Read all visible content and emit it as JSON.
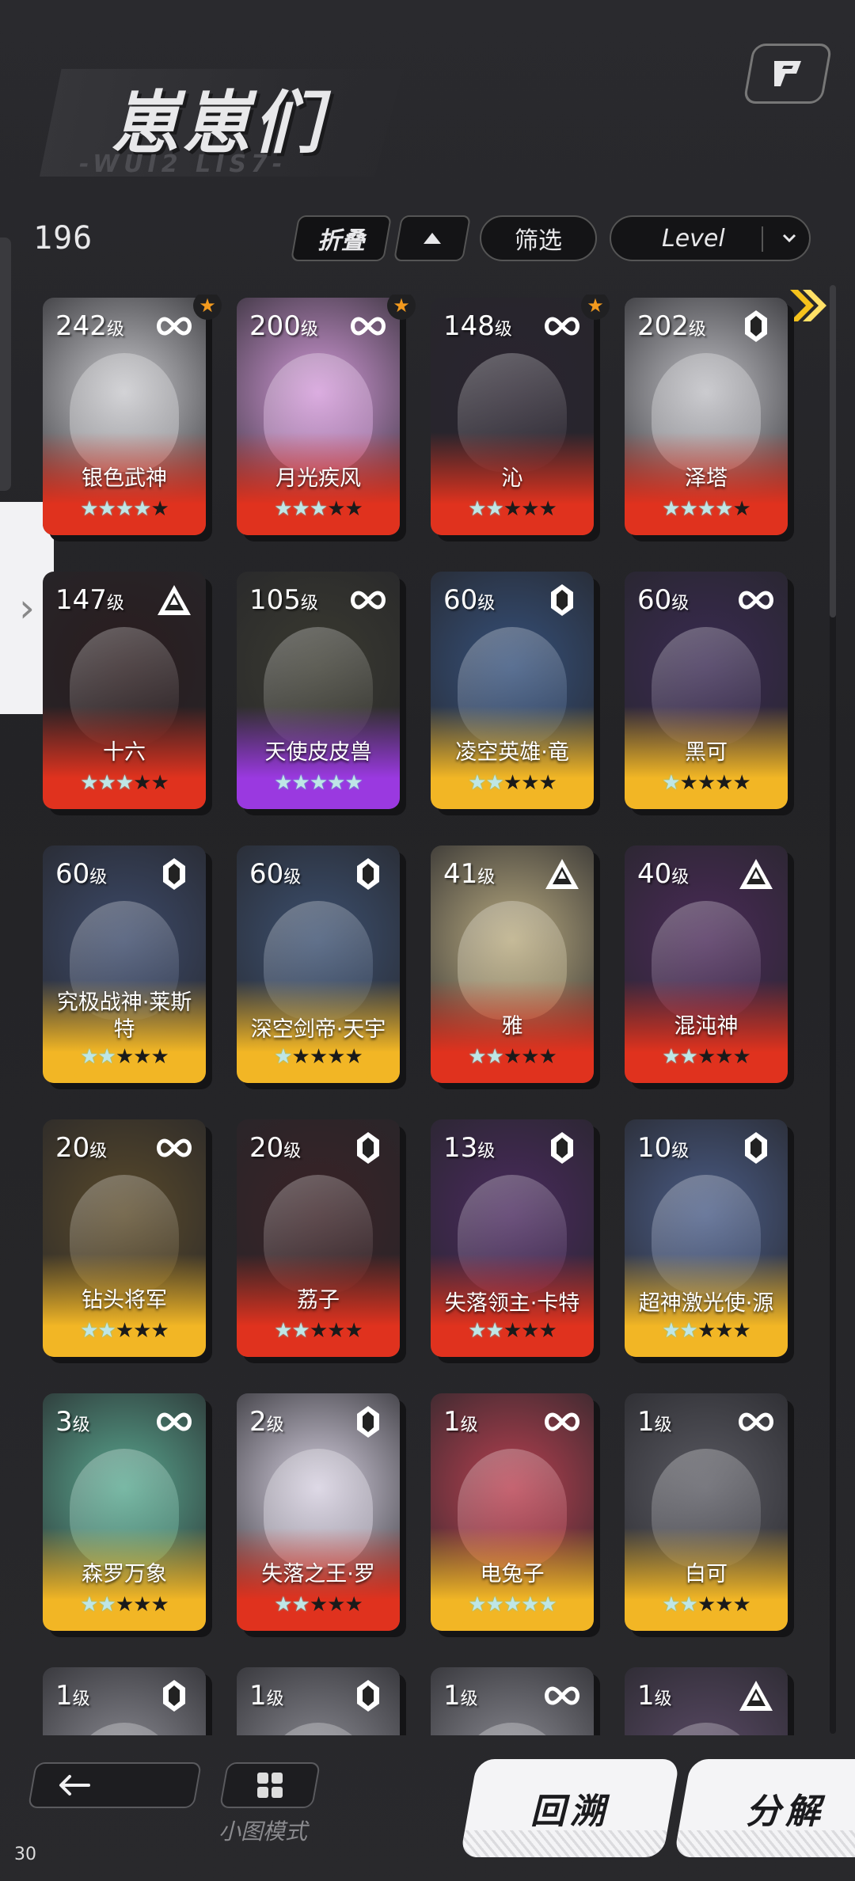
{
  "header": {
    "title": "崽崽们",
    "subtitle": "-WUI2 LIS7-",
    "count": "196"
  },
  "toolbar": {
    "fold_label": "折叠",
    "filter_label": "筛选",
    "sort_label": "Level"
  },
  "icons": {
    "top_right": "bookmark-flag-icon",
    "sort_dir": "triangle-up-icon",
    "chevron": "chevron-down-icon",
    "side_tab": "chevron-right-icon",
    "next": "double-arrow-right-icon",
    "back": "arrow-left-icon",
    "mini": "grid-icon"
  },
  "colors": {
    "red_rarity": "#e0321e",
    "gold_rarity": "#f2b625",
    "purple_rarity": "#9a39e0",
    "star": "#bfe6e6",
    "favorite": "#f39a1e"
  },
  "level_suffix": "级",
  "cards": [
    {
      "level": "242",
      "name": "银色武神",
      "badge": "infinity",
      "stars": 4,
      "max_stars": 5,
      "rarity": "red",
      "fav": true,
      "art": "#c9c9cd"
    },
    {
      "level": "200",
      "name": "月光疾风",
      "badge": "infinity",
      "stars": 3,
      "max_stars": 5,
      "rarity": "red",
      "fav": true,
      "art": "#d39ad9"
    },
    {
      "level": "148",
      "name": "沁",
      "badge": "infinity",
      "stars": 2,
      "max_stars": 5,
      "rarity": "red",
      "fav": true,
      "art": "#2a2430"
    },
    {
      "level": "202",
      "name": "泽塔",
      "badge": "crystal",
      "stars": 4,
      "max_stars": 5,
      "rarity": "red",
      "fav": false,
      "art": "#bfbfc4"
    },
    {
      "level": "147",
      "name": "十六",
      "badge": "triangle",
      "stars": 3,
      "max_stars": 5,
      "rarity": "red",
      "fav": false,
      "art": "#2a1c1e"
    },
    {
      "level": "105",
      "name": "天使皮皮兽",
      "badge": "infinity",
      "stars": 5,
      "max_stars": 5,
      "rarity": "purple",
      "fav": false,
      "art": "#3a3a30"
    },
    {
      "level": "60",
      "name": "凌空英雄·竜",
      "badge": "crystal",
      "stars": 2,
      "max_stars": 5,
      "rarity": "gold",
      "fav": false,
      "art": "#35507a"
    },
    {
      "level": "60",
      "name": "黑可",
      "badge": "infinity",
      "stars": 1,
      "max_stars": 5,
      "rarity": "gold",
      "fav": false,
      "art": "#3a2a52"
    },
    {
      "level": "60",
      "name": "究极战神·莱斯特",
      "badge": "crystal",
      "stars": 2,
      "max_stars": 5,
      "rarity": "gold",
      "fav": false,
      "art": "#3c4a6a"
    },
    {
      "level": "60",
      "name": "深空剑帝·天宇",
      "badge": "crystal",
      "stars": 1,
      "max_stars": 5,
      "rarity": "gold",
      "fav": false,
      "art": "#3c5070"
    },
    {
      "level": "41",
      "name": "雅",
      "badge": "triangle",
      "stars": 2,
      "max_stars": 5,
      "rarity": "red",
      "fav": false,
      "art": "#b8aa80"
    },
    {
      "level": "40",
      "name": "混沌神",
      "badge": "triangle",
      "stars": 2,
      "max_stars": 5,
      "rarity": "red",
      "fav": false,
      "art": "#4a2a58"
    },
    {
      "level": "20",
      "name": "钻头将军",
      "badge": "infinity",
      "stars": 2,
      "max_stars": 5,
      "rarity": "gold",
      "fav": false,
      "art": "#5a4a2a"
    },
    {
      "level": "20",
      "name": "荔子",
      "badge": "crystal",
      "stars": 2,
      "max_stars": 5,
      "rarity": "red",
      "fav": false,
      "art": "#3a2226"
    },
    {
      "level": "13",
      "name": "失落领主·卡特",
      "badge": "crystal",
      "stars": 2,
      "max_stars": 5,
      "rarity": "red",
      "fav": false,
      "art": "#4a2a5e"
    },
    {
      "level": "10",
      "name": "超神激光使·源",
      "badge": "crystal",
      "stars": 2,
      "max_stars": 5,
      "rarity": "gold",
      "fav": false,
      "art": "#4a5c86"
    },
    {
      "level": "3",
      "name": "森罗万象",
      "badge": "infinity",
      "stars": 2,
      "max_stars": 5,
      "rarity": "gold",
      "fav": false,
      "art": "#5aa890"
    },
    {
      "level": "2",
      "name": "失落之王·罗",
      "badge": "crystal",
      "stars": 2,
      "max_stars": 5,
      "rarity": "red",
      "fav": false,
      "art": "#d6d0e0"
    },
    {
      "level": "1",
      "name": "电兔子",
      "badge": "infinity",
      "stars": 5,
      "max_stars": 5,
      "rarity": "gold",
      "fav": false,
      "art": "#b84050"
    },
    {
      "level": "1",
      "name": "白可",
      "badge": "infinity",
      "stars": 2,
      "max_stars": 5,
      "rarity": "gold",
      "fav": false,
      "art": "#5a5a62"
    },
    {
      "level": "1",
      "name": "",
      "badge": "crystal",
      "stars": 0,
      "max_stars": 5,
      "rarity": "gold",
      "fav": false,
      "art": "#8a8a92"
    },
    {
      "level": "1",
      "name": "",
      "badge": "crystal",
      "stars": 0,
      "max_stars": 5,
      "rarity": "gold",
      "fav": false,
      "art": "#8a8a92"
    },
    {
      "level": "1",
      "name": "",
      "badge": "infinity",
      "stars": 0,
      "max_stars": 5,
      "rarity": "gold",
      "fav": false,
      "art": "#8a8a92"
    },
    {
      "level": "1",
      "name": "",
      "badge": "triangle",
      "stars": 0,
      "max_stars": 5,
      "rarity": "gold",
      "fav": false,
      "art": "#5a4a66"
    }
  ],
  "bottom": {
    "mini_mode_label": "小图模式",
    "restore_label": "回溯",
    "decompose_label": "分解"
  },
  "fps": "30"
}
